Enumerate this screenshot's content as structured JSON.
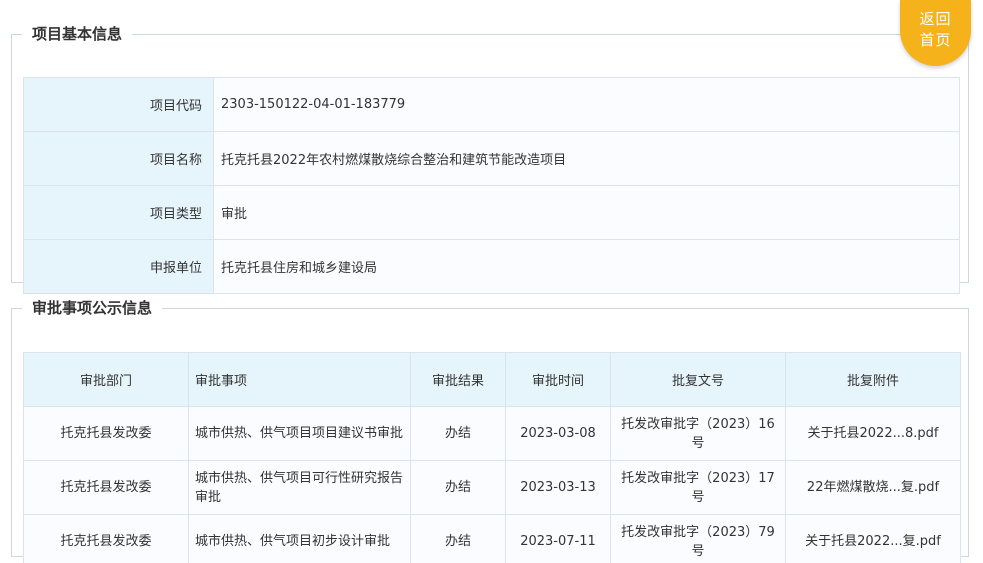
{
  "back_button": {
    "label": "返回首页"
  },
  "basic_info": {
    "title": "项目基本信息",
    "rows": [
      {
        "label": "项目代码",
        "value": "2303-150122-04-01-183779"
      },
      {
        "label": "项目名称",
        "value": "托克托县2022年农村燃煤散烧综合整治和建筑节能改造项目"
      },
      {
        "label": "项目类型",
        "value": "审批"
      },
      {
        "label": "申报单位",
        "value": "托克托县住房和城乡建设局"
      }
    ]
  },
  "approval_info": {
    "title": "审批事项公示信息",
    "headers": [
      "审批部门",
      "审批事项",
      "审批结果",
      "审批时间",
      "批复文号",
      "批复附件"
    ],
    "rows": [
      {
        "dept": "托克托县发改委",
        "item": "城市供热、供气项目项目建议书审批",
        "result": "办结",
        "date": "2023-03-08",
        "doc_no": "托发改审批字（2023）16号",
        "attachment": "关于托县2022...8.pdf"
      },
      {
        "dept": "托克托县发改委",
        "item": "城市供热、供气项目可行性研究报告审批",
        "result": "办结",
        "date": "2023-03-13",
        "doc_no": "托发改审批字（2023）17号",
        "attachment": "22年燃煤散烧...复.pdf"
      },
      {
        "dept": "托克托县发改委",
        "item": "城市供热、供气项目初步设计审批",
        "result": "办结",
        "date": "2023-07-11",
        "doc_no": "托发改审批字（2023）79号",
        "attachment": "关于托县2022...复.pdf"
      }
    ]
  }
}
